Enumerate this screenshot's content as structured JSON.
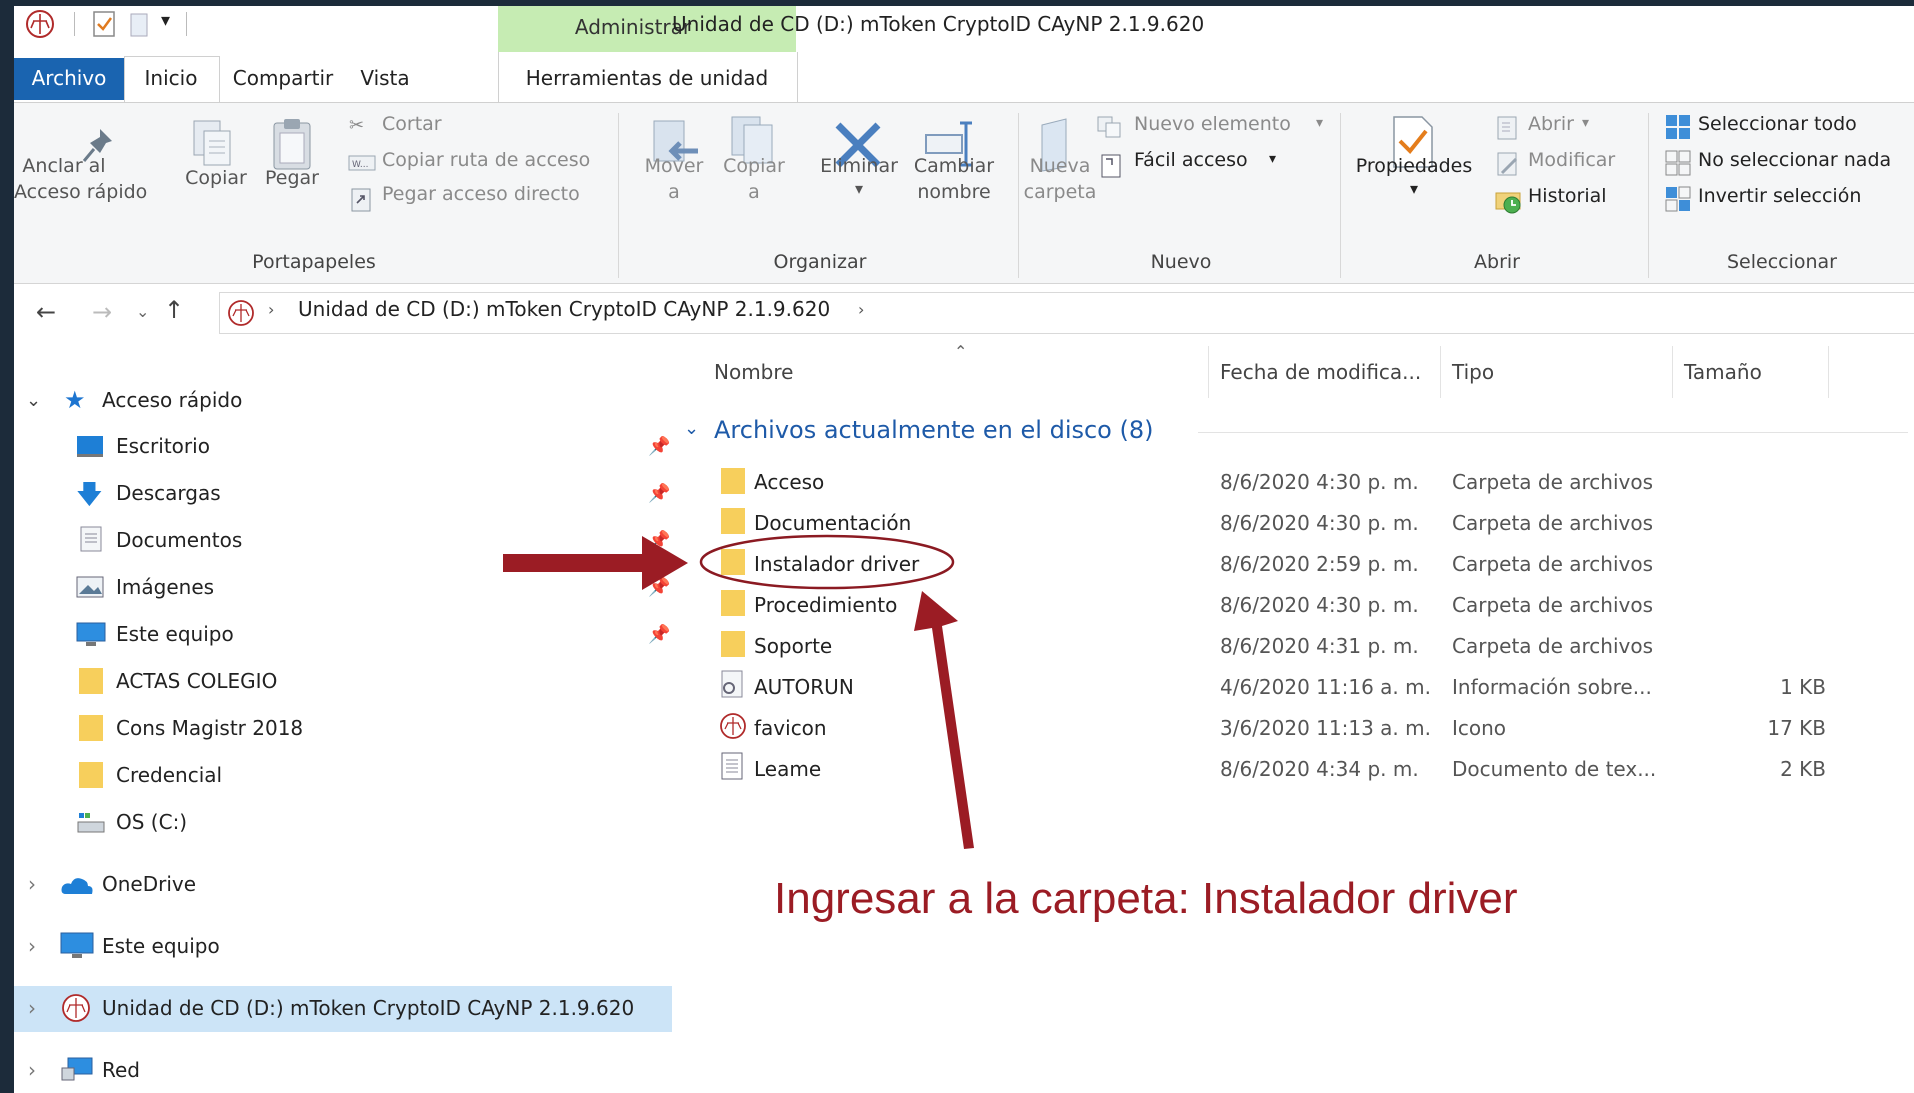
{
  "window": {
    "title": "Unidad de CD (D:) mToken CryptoID CAyNP 2.1.9.620",
    "context_tab_group": "Administrar"
  },
  "tabs": [
    "Archivo",
    "Inicio",
    "Compartir",
    "Vista",
    "Herramientas de unidad"
  ],
  "ribbon": {
    "portapapeles": {
      "label": "Portapapeles",
      "anclar_line1": "Anclar al",
      "anclar_line2": "Acceso rápido",
      "copiar": "Copiar",
      "pegar": "Pegar",
      "cortar": "Cortar",
      "copiar_ruta": "Copiar ruta de acceso",
      "pegar_acceso": "Pegar acceso directo"
    },
    "organizar": {
      "label": "Organizar",
      "mover_line1": "Mover",
      "mover_line2": "a",
      "copiar_line1": "Copiar",
      "copiar_line2": "a",
      "eliminar": "Eliminar",
      "cambiar_line1": "Cambiar",
      "cambiar_line2": "nombre"
    },
    "nuevo": {
      "label": "Nuevo",
      "nueva_line1": "Nueva",
      "nueva_line2": "carpeta",
      "nuevo_elemento": "Nuevo elemento",
      "facil_acceso": "Fácil acceso"
    },
    "abrir": {
      "label": "Abrir",
      "propiedades": "Propiedades",
      "abrir": "Abrir",
      "modificar": "Modificar",
      "historial": "Historial"
    },
    "seleccionar": {
      "label": "Seleccionar",
      "todo": "Seleccionar todo",
      "nada": "No seleccionar nada",
      "invertir": "Invertir selección"
    }
  },
  "address": {
    "path": "Unidad de CD (D:) mToken CryptoID CAyNP 2.1.9.620"
  },
  "nav": {
    "quick_access": "Acceso rápido",
    "items": [
      "Escritorio",
      "Descargas",
      "Documentos",
      "Imágenes",
      "Este equipo",
      "ACTAS COLEGIO",
      "Cons Magistr 2018",
      "Credencial",
      "OS (C:)"
    ],
    "onedrive": "OneDrive",
    "este_equipo": "Este equipo",
    "unidad": "Unidad de CD (D:) mToken CryptoID CAyNP 2.1.9.620",
    "red": "Red"
  },
  "columns": {
    "nombre": "Nombre",
    "fecha": "Fecha de modifica...",
    "tipo": "Tipo",
    "tamano": "Tamaño"
  },
  "group_header": "Archivos actualmente en el disco (8)",
  "files": [
    {
      "name": "Acceso",
      "date": "8/6/2020 4:30 p. m.",
      "type": "Carpeta de archivos",
      "size": ""
    },
    {
      "name": "Documentación",
      "date": "8/6/2020 4:30 p. m.",
      "type": "Carpeta de archivos",
      "size": ""
    },
    {
      "name": "Instalador driver",
      "date": "8/6/2020 2:59 p. m.",
      "type": "Carpeta de archivos",
      "size": ""
    },
    {
      "name": "Procedimiento",
      "date": "8/6/2020 4:30 p. m.",
      "type": "Carpeta de archivos",
      "size": ""
    },
    {
      "name": "Soporte",
      "date": "8/6/2020 4:31 p. m.",
      "type": "Carpeta de archivos",
      "size": ""
    },
    {
      "name": "AUTORUN",
      "date": "4/6/2020 11:16 a. m.",
      "type": "Información sobre...",
      "size": "1 KB"
    },
    {
      "name": "favicon",
      "date": "3/6/2020 11:13 a. m.",
      "type": "Icono",
      "size": "17 KB"
    },
    {
      "name": "Leame",
      "date": "8/6/2020 4:34 p. m.",
      "type": "Documento de tex...",
      "size": "2 KB"
    }
  ],
  "annotation": {
    "text": "Ingresar a la carpeta: Instalador driver",
    "color": "#9b1c24"
  }
}
